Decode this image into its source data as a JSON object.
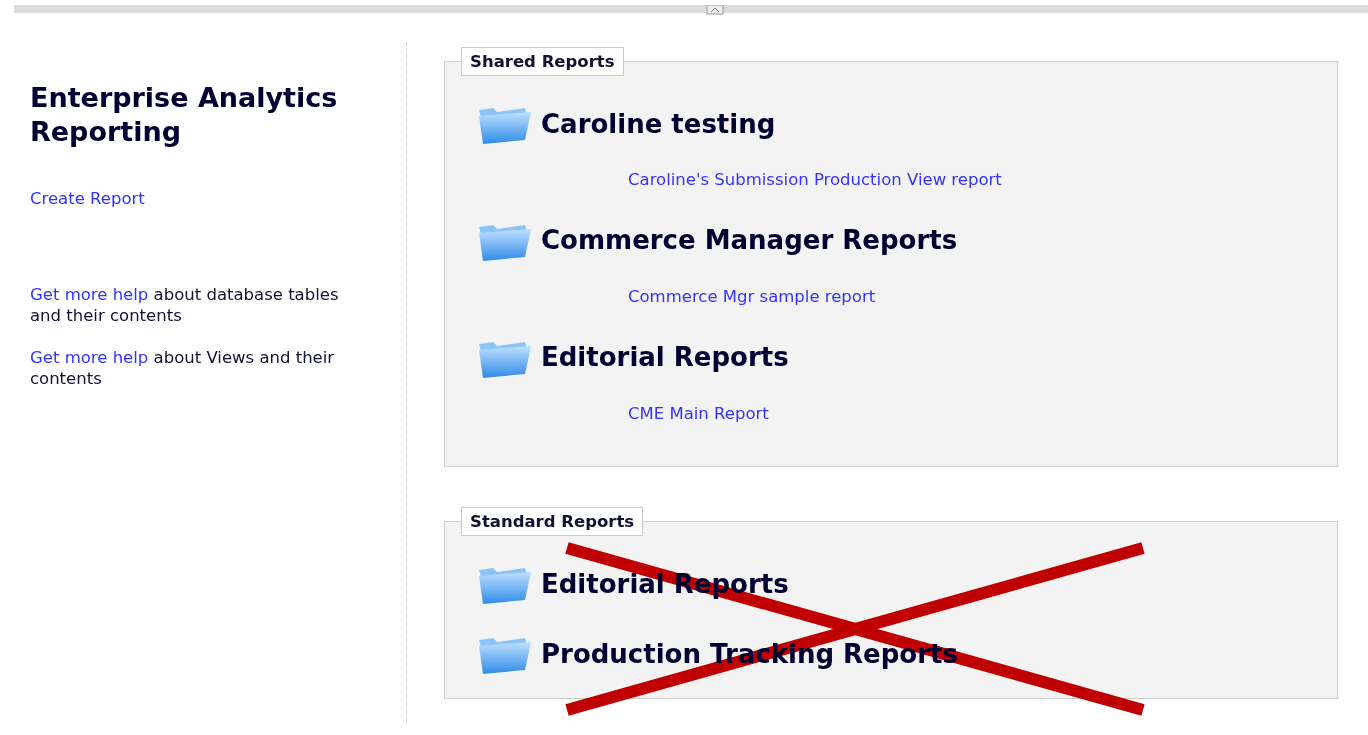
{
  "sidebar": {
    "title": "Enterprise Analytics Reporting",
    "links": [
      {
        "text": "Create Report"
      }
    ],
    "help": [
      {
        "link": "Get more help",
        "text": "about database tables and their contents"
      },
      {
        "link": "Get more help",
        "text": "about Views and their contents"
      }
    ]
  },
  "sections": [
    {
      "legend": "Shared Reports",
      "crossed_out": false,
      "folders": [
        {
          "name": "Caroline testing",
          "reports": [
            "Caroline's Submission Production View report"
          ]
        },
        {
          "name": "Commerce Manager Reports",
          "reports": [
            "Commerce Mgr sample report"
          ]
        },
        {
          "name": "Editorial Reports",
          "reports": [
            "CME Main Report"
          ]
        }
      ]
    },
    {
      "legend": "Standard Reports",
      "crossed_out": true,
      "folders": [
        {
          "name": "Editorial Reports"
        },
        {
          "name": "Production Tracking Reports"
        }
      ]
    }
  ]
}
